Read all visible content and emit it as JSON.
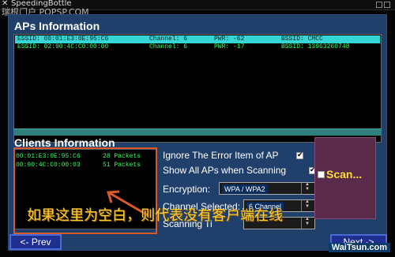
{
  "titlebar": {
    "title": "SpeedingBottle",
    "watermark": "瑞根门户 POPSP.COM"
  },
  "aps": {
    "header": "APs Information",
    "rows": [
      {
        "essid": "ESSID: 00:01:E3:0E:95:C6",
        "channel": "Channel: 6",
        "pwr": "PWR: -62",
        "bssid": "BSSID: CMCC",
        "selected": true
      },
      {
        "essid": "ESSID: 02:90:4C:C0:00:00",
        "channel": "Channel: 6",
        "pwr": "PWR: -17",
        "bssid": "BSSID: 13963260748",
        "selected": false
      }
    ]
  },
  "clients": {
    "header": "Clients Information",
    "rows": [
      {
        "mac": "00:01:E3:0E:95:C6",
        "packets": "28 Packets"
      },
      {
        "mac": "00:90:4C:C0:00:03",
        "packets": "51 Packets"
      }
    ]
  },
  "options": {
    "ignore_error": "Ignore The Error Item of AP",
    "show_all": "Show All APs when Scanning",
    "encryption_label": "Encryption:",
    "encryption_value": "WPA / WPA2",
    "channel_label": "Channel Selected:",
    "channel_value": "6 Channel",
    "scanning_label": "Scanning Ti"
  },
  "scan": {
    "label": "Scan..."
  },
  "buttons": {
    "prev": "<- Prev",
    "next": "Next ->"
  },
  "annotation": "如果这里为空白，则代表没有客户端在线",
  "watermark_bottom": "WaiTsun.com",
  "colors": {
    "panel": "#203f6a",
    "selected_row": "#35d6d6",
    "text_green": "#33ff66",
    "annotation": "#ffcc33",
    "scan_label": "#ffdd33"
  }
}
